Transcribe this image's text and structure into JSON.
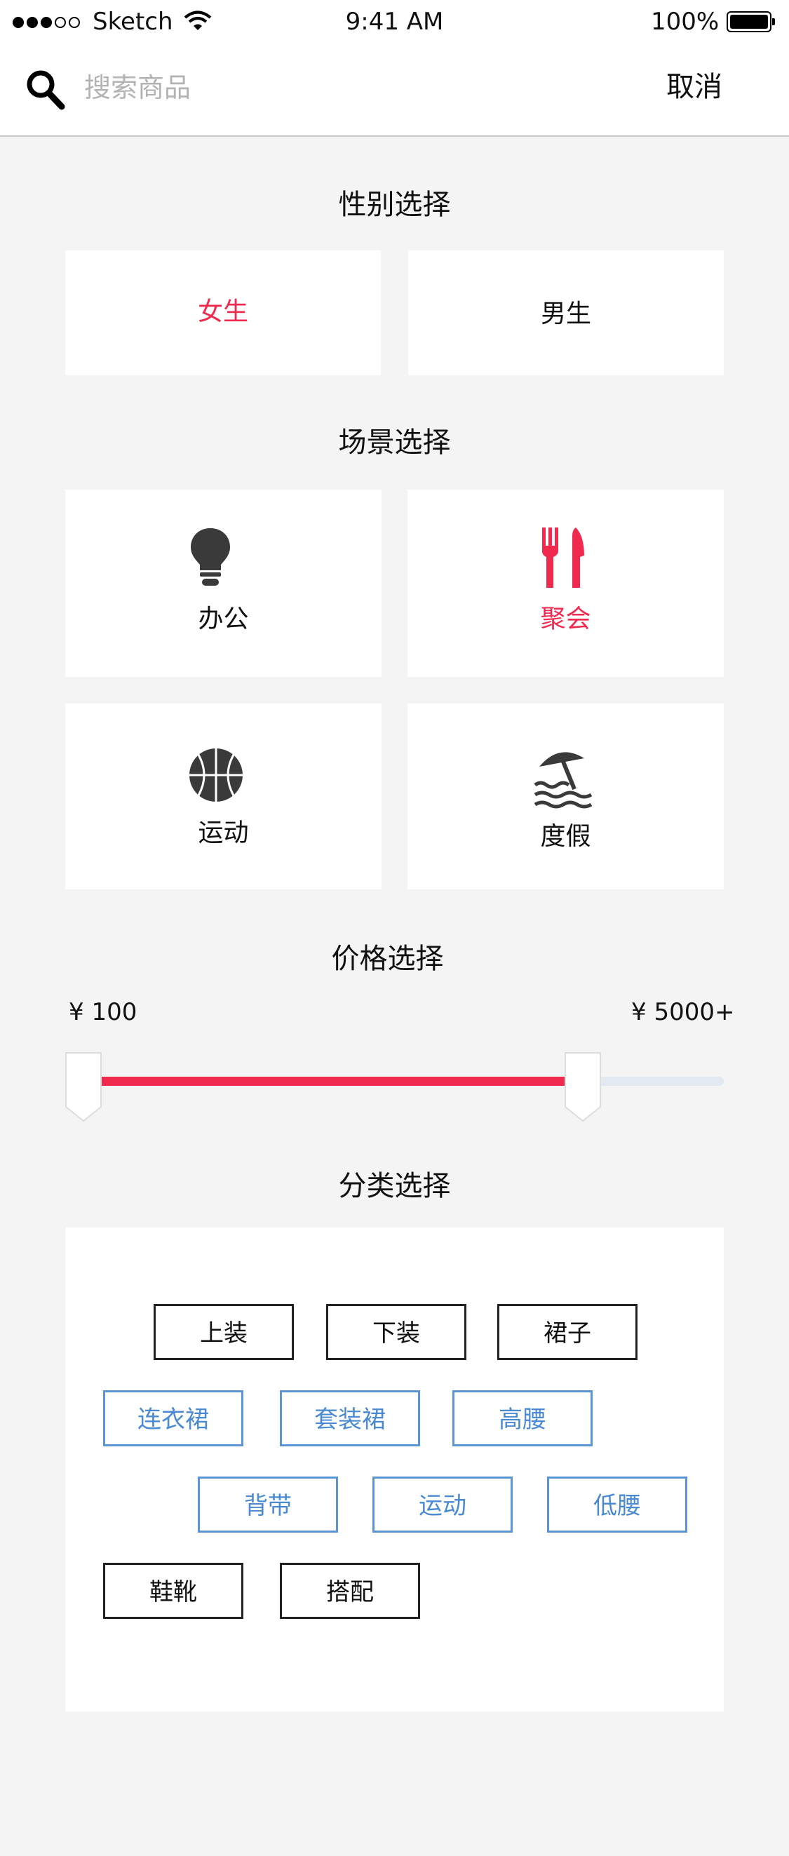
{
  "status_bar": {
    "carrier": "Sketch",
    "time": "9:41 AM",
    "battery": "100%"
  },
  "search": {
    "placeholder": "搜索商品",
    "value": "",
    "cancel_label": "取消"
  },
  "gender": {
    "title": "性别选择",
    "options": [
      {
        "label": "女生",
        "selected": true
      },
      {
        "label": "男生",
        "selected": false
      }
    ]
  },
  "scene": {
    "title": "场景选择",
    "options": [
      {
        "label": "办公",
        "icon": "lightbulb-icon",
        "selected": false
      },
      {
        "label": "聚会",
        "icon": "fork-knife-icon",
        "selected": true
      },
      {
        "label": "运动",
        "icon": "basketball-icon",
        "selected": false
      },
      {
        "label": "度假",
        "icon": "beach-umbrella-icon",
        "selected": false
      }
    ]
  },
  "price": {
    "title": "价格选择",
    "min_label": "¥ 100",
    "max_label": "¥ 5000+",
    "range_fill_fraction": 0.78
  },
  "category": {
    "title": "分类选择",
    "tags": [
      "上装",
      "下装",
      "裙子",
      "连衣裙",
      "套装裙",
      "高腰",
      "背带",
      "运动",
      "低腰",
      "鞋靴",
      "搭配"
    ]
  },
  "colors": {
    "accent": "#f0294f",
    "tag_blue": "#4a8ad2",
    "background": "#f4f4f4",
    "track": "#e3e9f0"
  }
}
